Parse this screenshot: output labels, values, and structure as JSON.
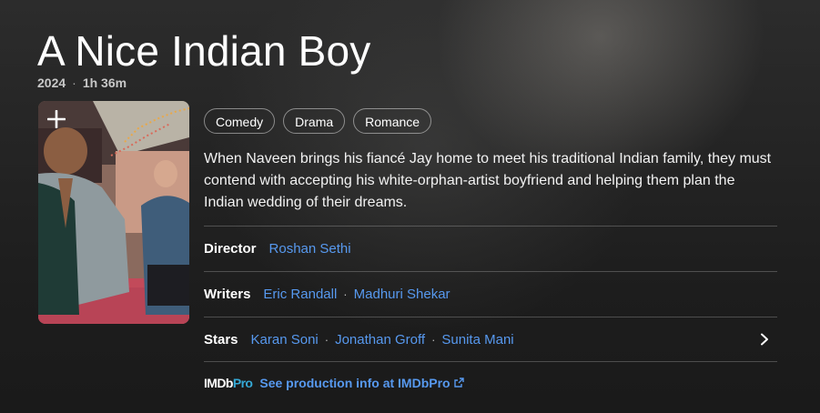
{
  "title": "A Nice Indian Boy",
  "meta": {
    "year": "2024",
    "separator": "·",
    "runtime": "1h 36m"
  },
  "poster": {
    "add_glyph": "+"
  },
  "genres": [
    "Comedy",
    "Drama",
    "Romance"
  ],
  "plot": "When Naveen brings his fiancé Jay home to meet his traditional Indian family, they must contend with accepting his white-orphan-artist boyfriend and helping them plan the Indian wedding of their dreams.",
  "credits": {
    "director": {
      "label": "Director",
      "names": [
        "Roshan Sethi"
      ]
    },
    "writers": {
      "label": "Writers",
      "names": [
        "Eric Randall",
        "Madhuri Shekar"
      ]
    },
    "stars": {
      "label": "Stars",
      "names": [
        "Karan Soni",
        "Jonathan Groff",
        "Sunita Mani"
      ]
    },
    "dot": "·"
  },
  "imdbpro": {
    "logo_a": "IMDb",
    "logo_b": "Pro",
    "link": "See production info at IMDbPro"
  },
  "colors": {
    "link": "#5799ef",
    "pro_accent": "#35a9d6"
  },
  "icons": {
    "add": "plus-icon",
    "chevron": "chevron-right-icon",
    "external": "external-link-icon"
  }
}
